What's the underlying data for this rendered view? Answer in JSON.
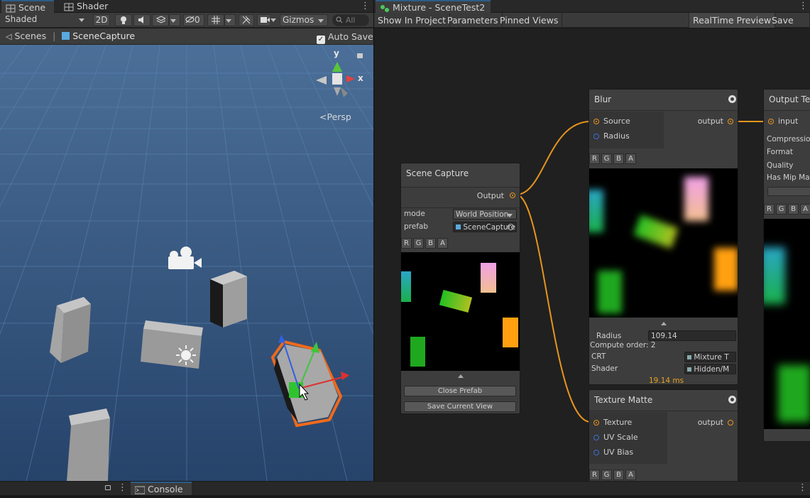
{
  "scene_panel": {
    "tabs": [
      {
        "label": "Scene"
      },
      {
        "label": "Shader"
      }
    ],
    "toolbar": {
      "shading_mode": "Shaded",
      "mode_2d": "2D",
      "hidden_count": "0",
      "gizmos": "Gizmos",
      "search_placeholder": "All"
    },
    "breadcrumb": {
      "root": "Scenes",
      "current": "SceneCapture"
    },
    "auto_save": {
      "label": "Auto Save",
      "checked": true
    },
    "orientation_gizmo": {
      "y": "y",
      "x": "x",
      "projection": "Persp"
    }
  },
  "mixture_panel": {
    "tab_title": "Mixture - SceneTest2",
    "toolbar": {
      "show_in_project": "Show In Project",
      "parameters": "Parameters",
      "pinned_views": "Pinned Views",
      "realtime_preview": "RealTime Preview",
      "save_all": "Save All"
    },
    "nodes": {
      "scene_capture": {
        "title": "Scene Capture",
        "output_label": "Output",
        "mode_label": "mode",
        "mode_value": "World Position",
        "prefab_label": "prefab",
        "prefab_value": "SceneCapture",
        "channels": [
          "R",
          "G",
          "B",
          "A"
        ],
        "close_prefab": "Close Prefab",
        "save_current_view": "Save Current View"
      },
      "blur": {
        "title": "Blur",
        "inputs": [
          {
            "label": "Source"
          },
          {
            "label": "Radius"
          }
        ],
        "output_label": "output",
        "channels": [
          "R",
          "G",
          "B",
          "A"
        ],
        "radius_label": "Radius",
        "radius_value": "109.14",
        "compute_order": "Compute order: 2",
        "crt_label": "CRT",
        "crt_value": "Mixture T",
        "shader_label": "Shader",
        "shader_value": "Hidden/M",
        "timing": "19.14 ms"
      },
      "output_texture": {
        "title": "Output Text",
        "input_label": "input",
        "props": [
          "Compression",
          "Format",
          "Quality",
          "Has Mip Map"
        ],
        "channels": [
          "R",
          "G",
          "B",
          "A"
        ]
      },
      "texture_matte": {
        "title": "Texture Matte",
        "inputs": [
          {
            "label": "Texture"
          },
          {
            "label": "UV Scale"
          },
          {
            "label": "UV Bias"
          }
        ],
        "output_label": "output",
        "channels": [
          "R",
          "G",
          "B",
          "A"
        ]
      }
    }
  },
  "bottom": {
    "console_tab": "Console"
  },
  "colors": {
    "port_orange": "#e6951e",
    "port_blue": "#3a6fd8",
    "wire": "#e6951e",
    "timing": "#e6a020",
    "selection": "#f06a1a"
  }
}
